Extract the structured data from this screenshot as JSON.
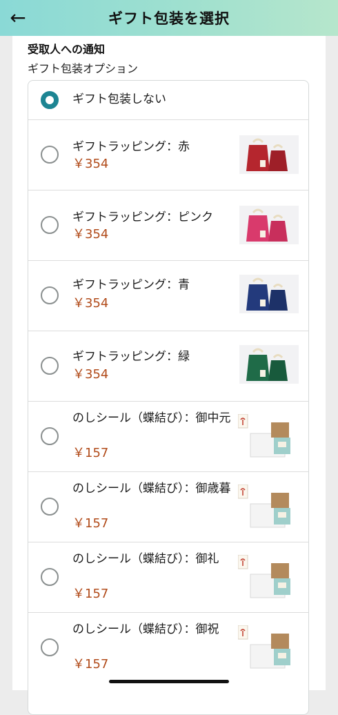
{
  "header": {
    "back_icon": "←",
    "title": "ギフト包装を選択"
  },
  "section": {
    "title": "受取人への通知",
    "subtitle": "ギフト包装オプション"
  },
  "options": [
    {
      "label": "ギフト包装しない",
      "selected": true
    },
    {
      "label": "ギフトラッピング：赤",
      "price": "￥354",
      "selected": false,
      "image": "red-gift-bags"
    },
    {
      "label": "ギフトラッピング：ピンク",
      "price": "￥354",
      "selected": false,
      "image": "pink-gift-bags"
    },
    {
      "label": "ギフトラッピング：青",
      "price": "￥354",
      "selected": false,
      "image": "blue-gift-bags"
    },
    {
      "label": "ギフトラッピング：緑",
      "price": "￥354",
      "selected": false,
      "image": "green-gift-bags"
    },
    {
      "label": "のしシール（蝶結び）：御中元",
      "price": "￥157",
      "selected": false,
      "image": "noshi-sticker-box"
    },
    {
      "label": "のしシール（蝶結び）：御歳暮",
      "price": "￥157",
      "selected": false,
      "image": "noshi-sticker-box"
    },
    {
      "label": "のしシール（蝶結び）：御礼",
      "price": "￥157",
      "selected": false,
      "image": "noshi-sticker-box"
    },
    {
      "label": "のしシール（蝶結び）：御祝",
      "price": "￥157",
      "selected": false,
      "image": "noshi-sticker-box"
    }
  ],
  "colors": {
    "header_gradient_start": "#8ad9d6",
    "header_gradient_end": "#b6e6cc",
    "radio_selected": "#1d8593",
    "price": "#b14b1a",
    "wrap_red": "#b5262e",
    "wrap_pink": "#d93a6c",
    "wrap_blue": "#233a7c",
    "wrap_green": "#1f6b48"
  }
}
